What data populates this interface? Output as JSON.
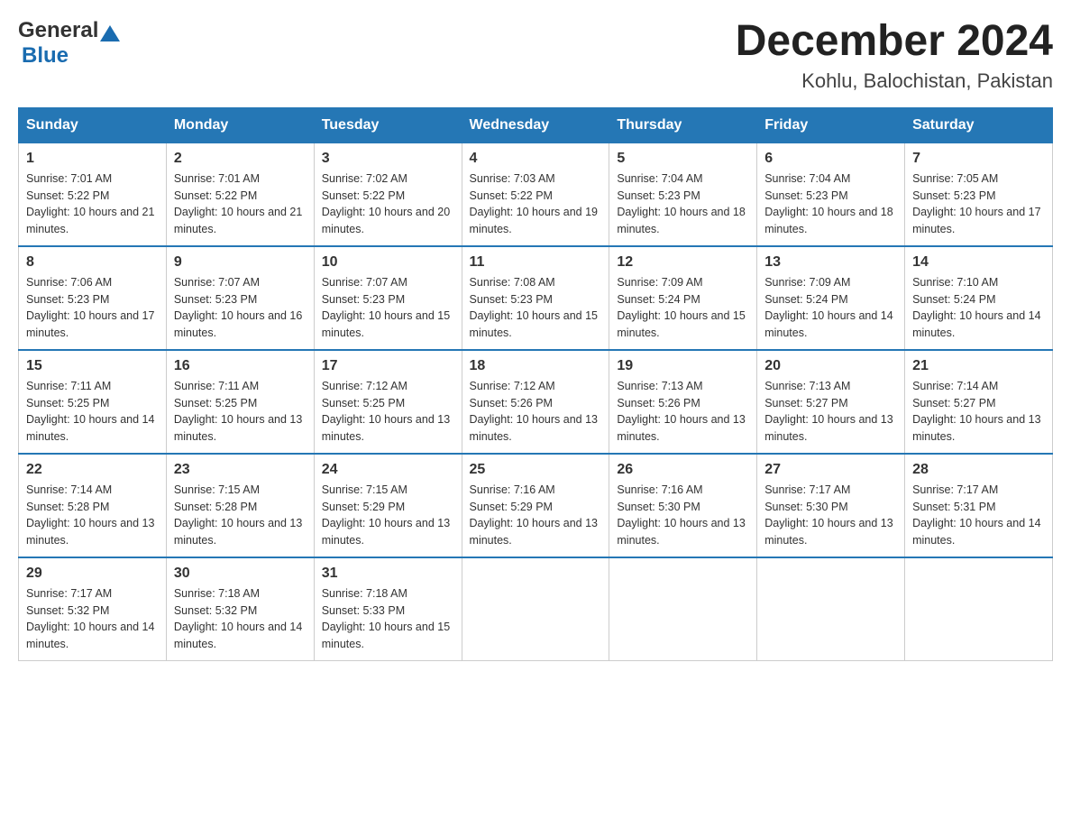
{
  "header": {
    "logo_general": "General",
    "logo_blue": "Blue",
    "title": "December 2024",
    "subtitle": "Kohlu, Balochistan, Pakistan"
  },
  "weekdays": [
    "Sunday",
    "Monday",
    "Tuesday",
    "Wednesday",
    "Thursday",
    "Friday",
    "Saturday"
  ],
  "weeks": [
    [
      {
        "day": "1",
        "sunrise": "7:01 AM",
        "sunset": "5:22 PM",
        "daylight": "10 hours and 21 minutes."
      },
      {
        "day": "2",
        "sunrise": "7:01 AM",
        "sunset": "5:22 PM",
        "daylight": "10 hours and 21 minutes."
      },
      {
        "day": "3",
        "sunrise": "7:02 AM",
        "sunset": "5:22 PM",
        "daylight": "10 hours and 20 minutes."
      },
      {
        "day": "4",
        "sunrise": "7:03 AM",
        "sunset": "5:22 PM",
        "daylight": "10 hours and 19 minutes."
      },
      {
        "day": "5",
        "sunrise": "7:04 AM",
        "sunset": "5:23 PM",
        "daylight": "10 hours and 18 minutes."
      },
      {
        "day": "6",
        "sunrise": "7:04 AM",
        "sunset": "5:23 PM",
        "daylight": "10 hours and 18 minutes."
      },
      {
        "day": "7",
        "sunrise": "7:05 AM",
        "sunset": "5:23 PM",
        "daylight": "10 hours and 17 minutes."
      }
    ],
    [
      {
        "day": "8",
        "sunrise": "7:06 AM",
        "sunset": "5:23 PM",
        "daylight": "10 hours and 17 minutes."
      },
      {
        "day": "9",
        "sunrise": "7:07 AM",
        "sunset": "5:23 PM",
        "daylight": "10 hours and 16 minutes."
      },
      {
        "day": "10",
        "sunrise": "7:07 AM",
        "sunset": "5:23 PM",
        "daylight": "10 hours and 15 minutes."
      },
      {
        "day": "11",
        "sunrise": "7:08 AM",
        "sunset": "5:23 PM",
        "daylight": "10 hours and 15 minutes."
      },
      {
        "day": "12",
        "sunrise": "7:09 AM",
        "sunset": "5:24 PM",
        "daylight": "10 hours and 15 minutes."
      },
      {
        "day": "13",
        "sunrise": "7:09 AM",
        "sunset": "5:24 PM",
        "daylight": "10 hours and 14 minutes."
      },
      {
        "day": "14",
        "sunrise": "7:10 AM",
        "sunset": "5:24 PM",
        "daylight": "10 hours and 14 minutes."
      }
    ],
    [
      {
        "day": "15",
        "sunrise": "7:11 AM",
        "sunset": "5:25 PM",
        "daylight": "10 hours and 14 minutes."
      },
      {
        "day": "16",
        "sunrise": "7:11 AM",
        "sunset": "5:25 PM",
        "daylight": "10 hours and 13 minutes."
      },
      {
        "day": "17",
        "sunrise": "7:12 AM",
        "sunset": "5:25 PM",
        "daylight": "10 hours and 13 minutes."
      },
      {
        "day": "18",
        "sunrise": "7:12 AM",
        "sunset": "5:26 PM",
        "daylight": "10 hours and 13 minutes."
      },
      {
        "day": "19",
        "sunrise": "7:13 AM",
        "sunset": "5:26 PM",
        "daylight": "10 hours and 13 minutes."
      },
      {
        "day": "20",
        "sunrise": "7:13 AM",
        "sunset": "5:27 PM",
        "daylight": "10 hours and 13 minutes."
      },
      {
        "day": "21",
        "sunrise": "7:14 AM",
        "sunset": "5:27 PM",
        "daylight": "10 hours and 13 minutes."
      }
    ],
    [
      {
        "day": "22",
        "sunrise": "7:14 AM",
        "sunset": "5:28 PM",
        "daylight": "10 hours and 13 minutes."
      },
      {
        "day": "23",
        "sunrise": "7:15 AM",
        "sunset": "5:28 PM",
        "daylight": "10 hours and 13 minutes."
      },
      {
        "day": "24",
        "sunrise": "7:15 AM",
        "sunset": "5:29 PM",
        "daylight": "10 hours and 13 minutes."
      },
      {
        "day": "25",
        "sunrise": "7:16 AM",
        "sunset": "5:29 PM",
        "daylight": "10 hours and 13 minutes."
      },
      {
        "day": "26",
        "sunrise": "7:16 AM",
        "sunset": "5:30 PM",
        "daylight": "10 hours and 13 minutes."
      },
      {
        "day": "27",
        "sunrise": "7:17 AM",
        "sunset": "5:30 PM",
        "daylight": "10 hours and 13 minutes."
      },
      {
        "day": "28",
        "sunrise": "7:17 AM",
        "sunset": "5:31 PM",
        "daylight": "10 hours and 14 minutes."
      }
    ],
    [
      {
        "day": "29",
        "sunrise": "7:17 AM",
        "sunset": "5:32 PM",
        "daylight": "10 hours and 14 minutes."
      },
      {
        "day": "30",
        "sunrise": "7:18 AM",
        "sunset": "5:32 PM",
        "daylight": "10 hours and 14 minutes."
      },
      {
        "day": "31",
        "sunrise": "7:18 AM",
        "sunset": "5:33 PM",
        "daylight": "10 hours and 15 minutes."
      },
      null,
      null,
      null,
      null
    ]
  ]
}
